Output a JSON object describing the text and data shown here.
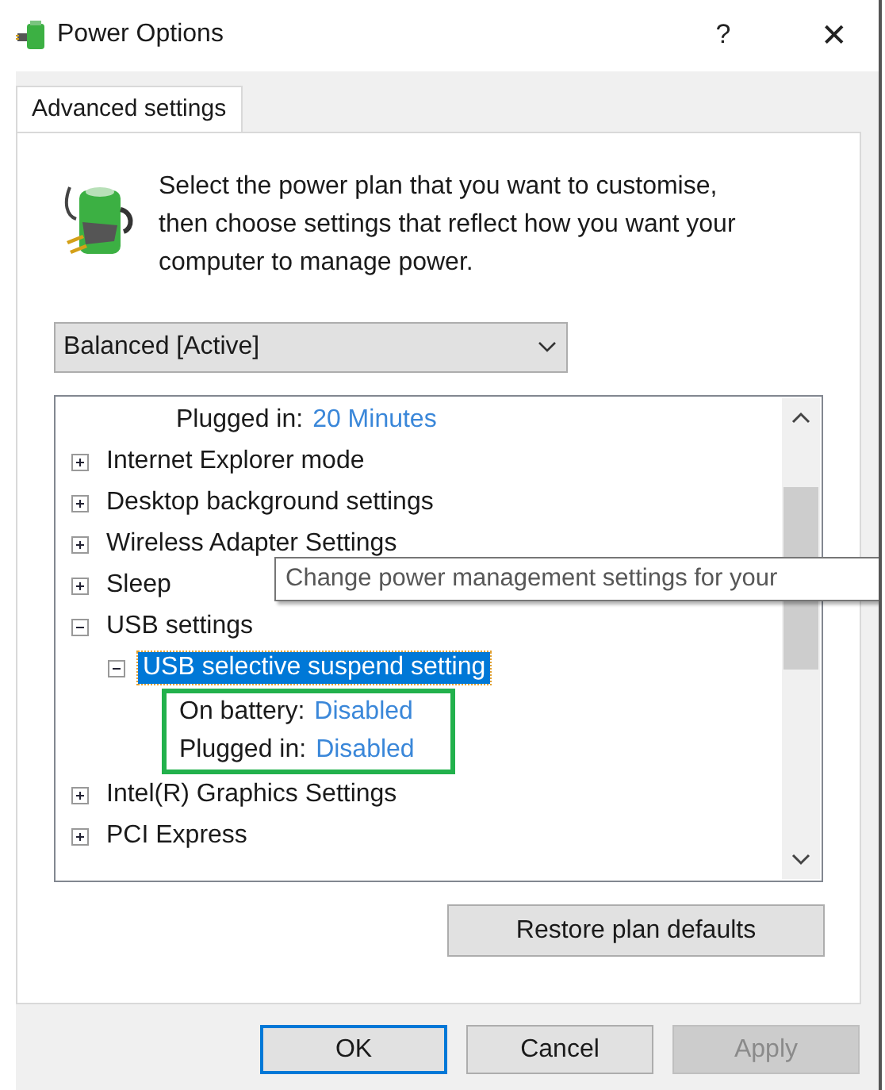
{
  "window": {
    "title": "Power Options",
    "help": "?",
    "close": "✕"
  },
  "tabs": [
    {
      "label": "Advanced settings",
      "selected": true
    }
  ],
  "intro": "Select the power plan that you want to customise, then choose settings that reflect how you want your computer to manage power.",
  "plan_dropdown": {
    "value": "Balanced [Active]"
  },
  "tree": [
    {
      "kind": "setting",
      "label": "Plugged in:",
      "value": "20 Minutes"
    },
    {
      "kind": "group",
      "label": "Internet Explorer mode",
      "expanded": false,
      "selected": false
    },
    {
      "kind": "group",
      "label": "Desktop background settings",
      "expanded": false,
      "selected": false
    },
    {
      "kind": "group",
      "label": "Wireless Adapter Settings",
      "expanded": false,
      "selected": false
    },
    {
      "kind": "group",
      "label": "Sleep",
      "expanded": false,
      "selected": false
    },
    {
      "kind": "group",
      "label": "USB settings",
      "expanded": true,
      "selected": false,
      "children": [
        {
          "kind": "group",
          "label": "USB selective suspend setting",
          "expanded": true,
          "selected": true,
          "outlined": true,
          "children": [
            {
              "kind": "setting",
              "label": "On battery:",
              "value": "Disabled"
            },
            {
              "kind": "setting",
              "label": "Plugged in:",
              "value": "Disabled"
            }
          ]
        }
      ]
    },
    {
      "kind": "group",
      "label": "Intel(R) Graphics Settings",
      "expanded": false,
      "selected": false
    },
    {
      "kind": "group",
      "label": "PCI Express",
      "expanded": false,
      "selected": false
    }
  ],
  "tooltip": "Change power management settings for your",
  "restore_button": "Restore plan defaults",
  "buttons": [
    {
      "label": "OK",
      "default": true,
      "disabled": false
    },
    {
      "label": "Cancel",
      "default": false,
      "disabled": false
    },
    {
      "label": "Apply",
      "default": false,
      "disabled": true
    }
  ]
}
